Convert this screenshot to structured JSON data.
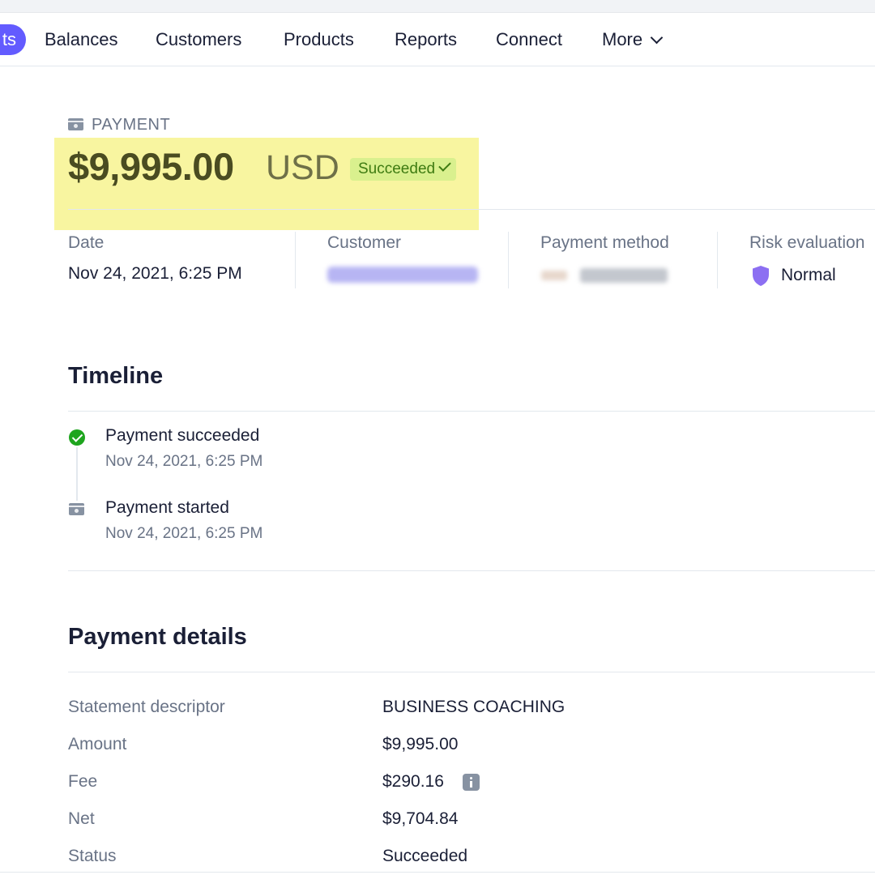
{
  "nav": {
    "active_fragment": "ts",
    "items": [
      "Balances",
      "Customers",
      "Products",
      "Reports",
      "Connect",
      "More"
    ]
  },
  "header": {
    "label": "PAYMENT",
    "amount": "$9,995.00",
    "currency": "USD",
    "status_badge": "Succeeded"
  },
  "summary": {
    "date_label": "Date",
    "date_value": "Nov 24, 2021, 6:25 PM",
    "customer_label": "Customer",
    "payment_method_label": "Payment method",
    "risk_label": "Risk evaluation",
    "risk_value": "Normal"
  },
  "timeline": {
    "title": "Timeline",
    "events": [
      {
        "title": "Payment succeeded",
        "time": "Nov 24, 2021, 6:25 PM"
      },
      {
        "title": "Payment started",
        "time": "Nov 24, 2021, 6:25 PM"
      }
    ]
  },
  "details": {
    "title": "Payment details",
    "rows": [
      {
        "label": "Statement descriptor",
        "value": "BUSINESS COACHING"
      },
      {
        "label": "Amount",
        "value": "$9,995.00"
      },
      {
        "label": "Fee",
        "value": "$290.16"
      },
      {
        "label": "Net",
        "value": "$9,704.84"
      },
      {
        "label": "Status",
        "value": "Succeeded"
      }
    ]
  },
  "colors": {
    "accent": "#635bff",
    "success": "#1ea51e",
    "highlight": "#f8f5a0"
  }
}
